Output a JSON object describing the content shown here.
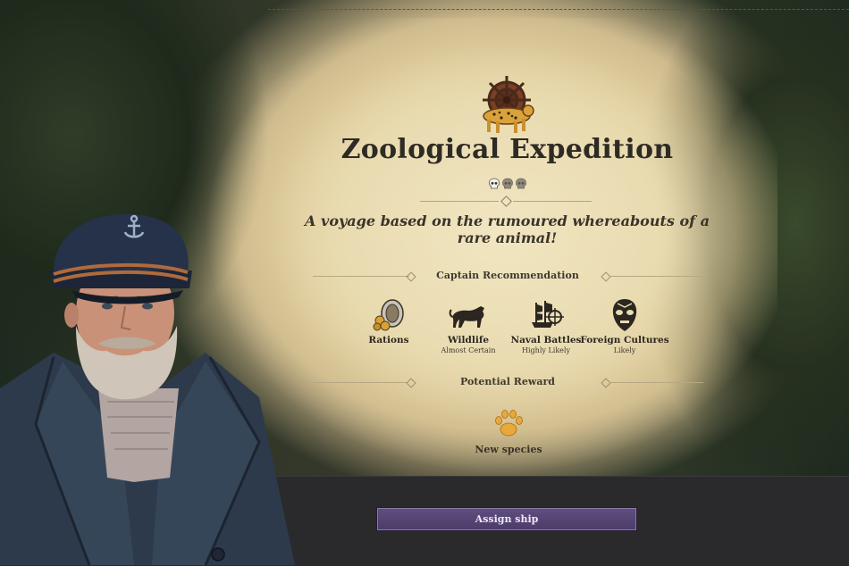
{
  "expedition": {
    "title": "Zoological Expedition",
    "subtitle": "A voyage based on the rumoured whereabouts of a rare animal!",
    "difficulty": {
      "active": 1,
      "total": 3
    },
    "emblem_icon": "ship-wheel-leopard-icon"
  },
  "captain_recommendation": {
    "heading": "Captain Recommendation",
    "items": [
      {
        "label": "Rations",
        "sub": "",
        "icon": "rations-icon"
      },
      {
        "label": "Wildlife",
        "sub": "Almost Certain",
        "icon": "panther-icon"
      },
      {
        "label": "Naval Battles",
        "sub": "Highly Likely",
        "icon": "naval-battle-icon"
      },
      {
        "label": "Foreign Cultures",
        "sub": "Likely",
        "icon": "tribal-mask-icon"
      }
    ]
  },
  "potential_reward": {
    "heading": "Potential Reward",
    "label": "New species",
    "icon": "paw-print-icon",
    "icon_color": "#e8a93a"
  },
  "actions": {
    "assign_ship": "Assign ship"
  },
  "colors": {
    "button": "#56467a",
    "parchment": "#ecdfb6",
    "bottom_bar": "#2a2a2c"
  }
}
